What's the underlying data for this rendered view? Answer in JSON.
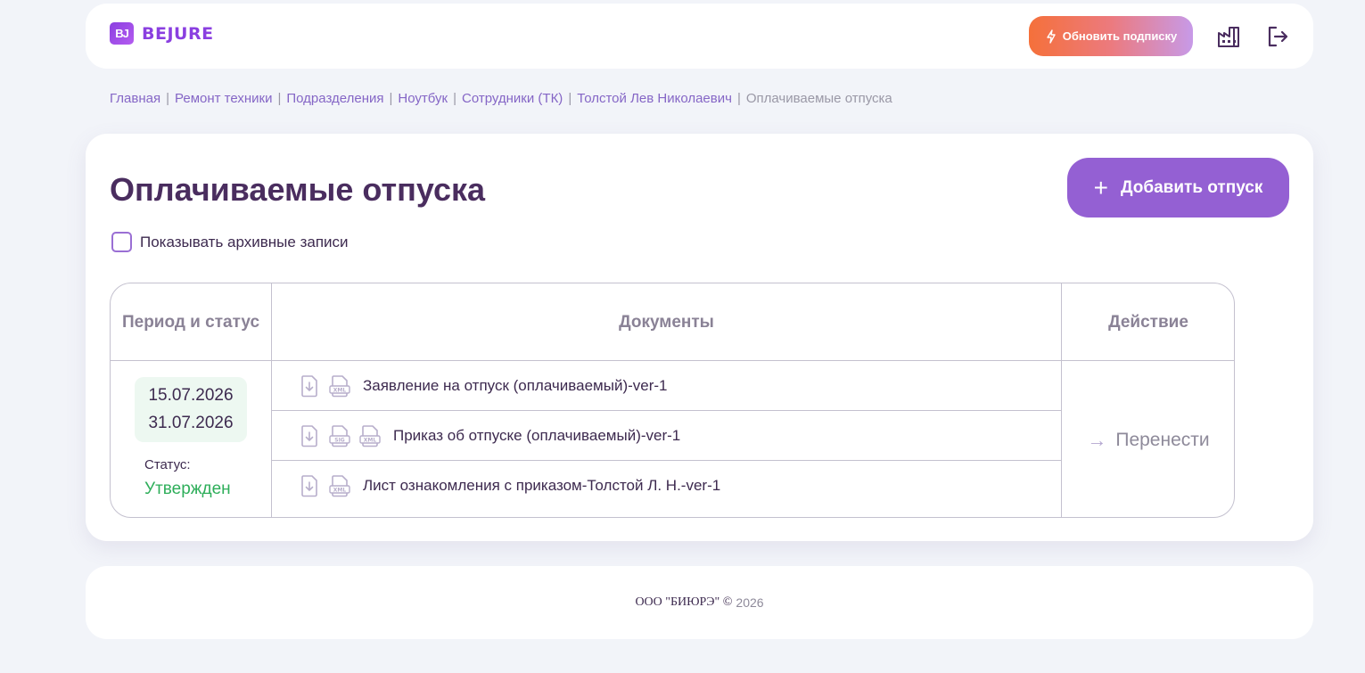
{
  "app": {
    "logo_mark": "BJ",
    "logo_text": "BEJURE"
  },
  "header": {
    "upgrade_label": "Обновить подписку"
  },
  "breadcrumb": [
    {
      "label": "Главная"
    },
    {
      "label": "Ремонт техники"
    },
    {
      "label": "Подразделения"
    },
    {
      "label": "Ноутбук"
    },
    {
      "label": "Сотрудники (ТК)"
    },
    {
      "label": "Толстой Лев Николаевич"
    },
    {
      "label": "Оплачиваемые отпуска"
    }
  ],
  "breadcrumb_separator": "|",
  "page": {
    "title": "Оплачиваемые отпуска",
    "add_button_label": "Добавить отпуск",
    "add_button_icon": "+",
    "archive_label": "Показывать архивные записи",
    "archive_checked": false
  },
  "table": {
    "headers": {
      "period": "Период и статус",
      "documents": "Документы",
      "action": "Действие"
    },
    "row": {
      "date_start": "15.07.2026",
      "date_end": "31.07.2026",
      "status_label": "Статус:",
      "status_value": "Утвержден",
      "status_color": "#2eae5a",
      "documents": [
        {
          "name": "Заявление на отпуск (оплачиваемый)-ver-1",
          "icons": [
            "download-icon",
            "xml-file-icon"
          ]
        },
        {
          "name": "Приказ об отпуске (оплачиваемый)-ver-1",
          "icons": [
            "download-icon",
            "sig-file-icon",
            "xml-file-icon"
          ]
        },
        {
          "name": "Лист ознакомления с приказом-Толстой Л. Н.-ver-1",
          "icons": [
            "download-icon",
            "xml-file-icon"
          ]
        }
      ],
      "action_label": "Перенести",
      "action_icon": "→"
    }
  },
  "footer": {
    "company": "ООО \"БИЮРЭ\" ©",
    "year": "2026"
  },
  "colors": {
    "accent": "#9460d3",
    "title": "#4a2d5f",
    "breadcrumb": "#8566c6",
    "background": "#f2f4f9"
  }
}
